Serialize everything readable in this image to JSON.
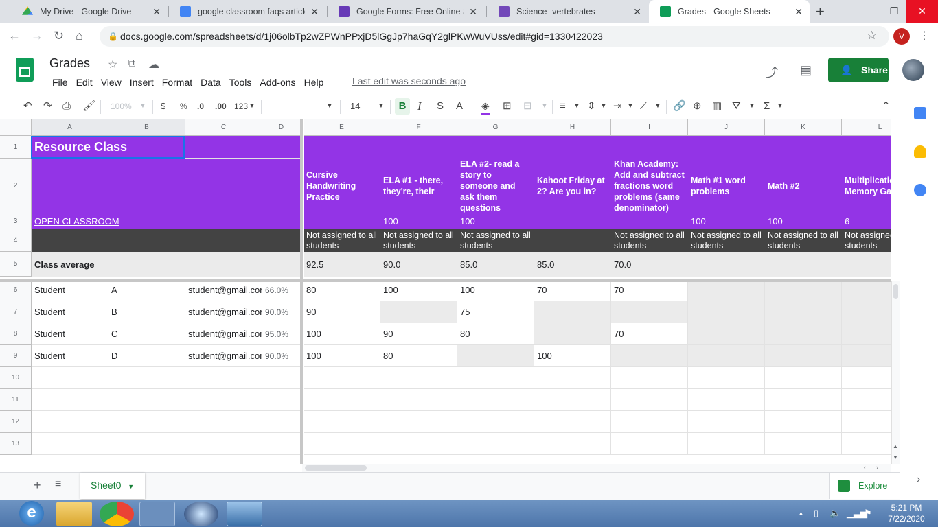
{
  "browser": {
    "tabs": [
      {
        "title": "My Drive - Google Drive",
        "favicon": "drive-icon",
        "color": "#fbbc04"
      },
      {
        "title": "google classroom faqs article.do",
        "favicon": "docs-icon",
        "color": "#4285f4"
      },
      {
        "title": "Google Forms: Free Online Surve",
        "favicon": "forms-icon",
        "color": "#673ab7"
      },
      {
        "title": "Science- vertebrates",
        "favicon": "classroom-icon",
        "color": "#7248b9"
      },
      {
        "title": "Grades - Google Sheets",
        "favicon": "sheets-icon",
        "color": "#0f9d58"
      }
    ],
    "url": "docs.google.com/spreadsheets/d/1j06olbTp2wZPWnPPxjD5lGgJp7haGqY2glPKwWuVUss/edit#gid=1330422023",
    "profile_initial": "V"
  },
  "app": {
    "title": "Grades",
    "menus": [
      "File",
      "Edit",
      "View",
      "Insert",
      "Format",
      "Data",
      "Tools",
      "Add-ons",
      "Help"
    ],
    "last_edit": "Last edit was seconds ago",
    "share_label": "Share"
  },
  "toolbar": {
    "zoom": "100%",
    "currency": "$",
    "percent": "%",
    "dec_decrease": ".0",
    "dec_increase": ".00",
    "more_formats": "123",
    "font_size": "14",
    "bold": "B",
    "italic": "I",
    "strike": "S",
    "text_color": "A"
  },
  "grid": {
    "columns": [
      "A",
      "B",
      "C",
      "D",
      "E",
      "F",
      "G",
      "H",
      "I",
      "J",
      "K",
      "L"
    ],
    "rows": [
      "1",
      "2",
      "3",
      "4",
      "5",
      "6",
      "7",
      "8",
      "9",
      "10",
      "11",
      "12",
      "13"
    ],
    "class_name": "Resource Class",
    "open_classroom": "OPEN CLASSROOM",
    "class_average_label": "Class average",
    "assignments": [
      {
        "title": "Cursive Handwriting Practice",
        "points": "",
        "assigned": "Not assigned to all students",
        "average": "92.5"
      },
      {
        "title": "ELA #1 - there, they're, their",
        "points": "100",
        "assigned": "Not assigned to all students",
        "average": "90.0"
      },
      {
        "title": "ELA #2- read a story to someone and ask them questions",
        "points": "100",
        "assigned": "Not assigned to all students",
        "average": "85.0"
      },
      {
        "title": "Kahoot Friday at 2? Are you in?",
        "points": "",
        "assigned": "",
        "average": "85.0"
      },
      {
        "title": "Khan Academy: Add and subtract fractions word problems (same denominator)",
        "points": "",
        "assigned": "Not assigned to all students",
        "average": "70.0"
      },
      {
        "title": "Math #1  word problems",
        "points": "100",
        "assigned": "Not assigned to all students",
        "average": ""
      },
      {
        "title": "Math #2",
        "points": "100",
        "assigned": "Not assigned to all students",
        "average": ""
      },
      {
        "title": "Multiplication Memory Game",
        "points": "6",
        "assigned": "Not assigned to all students",
        "average": ""
      }
    ],
    "students": [
      {
        "first": "Student",
        "last": "A",
        "email": "student@gmail.com",
        "overall": "66.0%",
        "grades": [
          "80",
          "100",
          "100",
          "70",
          "70",
          "",
          "",
          ""
        ]
      },
      {
        "first": "Student",
        "last": "B",
        "email": "student@gmail.com",
        "overall": "90.0%",
        "grades": [
          "90",
          "",
          "75",
          "",
          "",
          "",
          "",
          ""
        ]
      },
      {
        "first": "Student",
        "last": "C",
        "email": "student@gmail.com",
        "overall": "95.0%",
        "grades": [
          "100",
          "90",
          "80",
          "",
          "70",
          "",
          "",
          ""
        ]
      },
      {
        "first": "Student",
        "last": "D",
        "email": "student@gmail.com",
        "overall": "90.0%",
        "grades": [
          "100",
          "80",
          "",
          "100",
          "",
          "",
          "",
          ""
        ]
      }
    ],
    "header_color": "#9334e6",
    "dark_row_color": "#434343"
  },
  "sheets": {
    "active": "Sheet0",
    "explore_label": "Explore"
  },
  "taskbar": {
    "time": "5:21 PM",
    "date": "7/22/2020"
  }
}
